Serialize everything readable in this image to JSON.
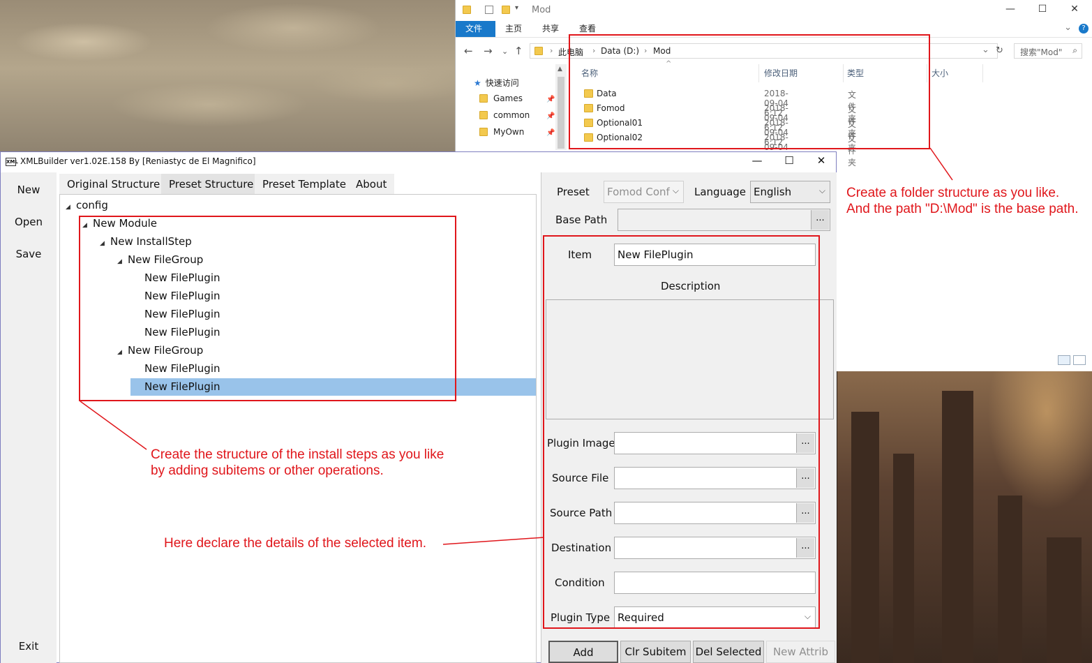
{
  "explorer": {
    "title": "Mod",
    "ribbon_tabs": [
      "文件",
      "主页",
      "共享",
      "查看"
    ],
    "help_icon": "?",
    "address_crumbs": [
      "此电脑",
      "Data (D:)",
      "Mod"
    ],
    "search_placeholder": "搜索\"Mod\"",
    "sidebar": {
      "quick_access": "快速访问",
      "items": [
        "Games",
        "common",
        "MyOwn"
      ]
    },
    "columns": [
      "名称",
      "修改日期",
      "类型",
      "大小"
    ],
    "rows": [
      {
        "name": "Data",
        "date": "2018-09-04 6:12",
        "type": "文件夹"
      },
      {
        "name": "Fomod",
        "date": "2018-09-04 6:12",
        "type": "文件夹"
      },
      {
        "name": "Optional01",
        "date": "2018-09-04 6:12",
        "type": "文件夹"
      },
      {
        "name": "Optional02",
        "date": "2018-09-04 6:13",
        "type": "文件夹"
      }
    ]
  },
  "xmlbuilder": {
    "title": "XMLBuilder ver1.02E.158 By [Reniastyc de El Magnifico]",
    "app_icon": "XML",
    "left_buttons": {
      "new": "New",
      "open": "Open",
      "save": "Save",
      "exit": "Exit"
    },
    "tabs": [
      "Original Structure",
      "Preset Structure",
      "Preset Template",
      "About"
    ],
    "tree": {
      "root": "config",
      "module": "New Module",
      "install_step": "New InstallStep",
      "group1": "New FileGroup",
      "group1_plugins": [
        "New FilePlugin",
        "New FilePlugin",
        "New FilePlugin",
        "New FilePlugin"
      ],
      "group2": "New FileGroup",
      "group2_plugins": [
        "New FilePlugin",
        "New FilePlugin"
      ]
    },
    "panel": {
      "preset_label": "Preset",
      "preset_value": "Fomod Conf",
      "language_label": "Language",
      "language_value": "English",
      "base_path_label": "Base Path",
      "base_path_value": "",
      "item_label": "Item",
      "item_value": "New FilePlugin",
      "description_label": "Description",
      "plugin_image_label": "Plugin Image",
      "source_file_label": "Source File",
      "source_path_label": "Source Path",
      "destination_label": "Destination",
      "condition_label": "Condition",
      "plugin_type_label": "Plugin Type",
      "plugin_type_value": "Required",
      "browse": "..."
    },
    "bottom_buttons": [
      "Add Subitem",
      "Clr Subitem",
      "Del Selected",
      "New Attrib"
    ]
  },
  "annotations": {
    "folder_note_line1": "Create a folder structure as you like.",
    "folder_note_line2": "And the path \"D:\\Mod\" is the base path.",
    "tree_note_line1": "Create the structure of the install steps as you like",
    "tree_note_line2": "by adding subitems or other operations.",
    "details_note": "Here declare the details of the selected item."
  },
  "colors": {
    "annotation_red": "#e0161b",
    "selection": "#99c3ea",
    "ribbon_blue": "#1979ca"
  }
}
